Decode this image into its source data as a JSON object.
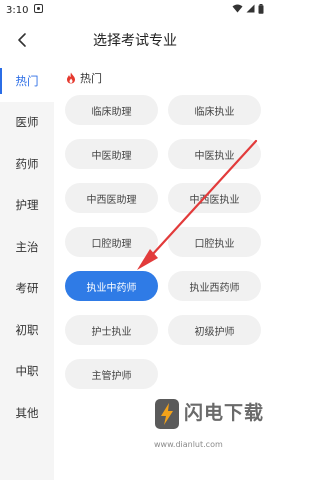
{
  "status_bar": {
    "time": "3:10"
  },
  "nav": {
    "title": "选择考试专业"
  },
  "sidebar": {
    "items": [
      {
        "label": "热门",
        "active": true
      },
      {
        "label": "医师"
      },
      {
        "label": "药师"
      },
      {
        "label": "护理"
      },
      {
        "label": "主治"
      },
      {
        "label": "考研"
      },
      {
        "label": "初职"
      },
      {
        "label": "中职"
      },
      {
        "label": "其他"
      }
    ]
  },
  "section": {
    "title": "热门",
    "icon": "fire-icon"
  },
  "tags": [
    "临床助理",
    "临床执业",
    "中医助理",
    "中医执业",
    "中西医助理",
    "中西医执业",
    "口腔助理",
    "口腔执业",
    "执业中药师",
    "执业西药师",
    "护士执业",
    "初级护师",
    "主管护师"
  ],
  "selected_tag": "执业中药师",
  "colors": {
    "accent": "#2f7be6",
    "arrow": "#e23b3b"
  },
  "watermark": {
    "title": "闪电下载",
    "url": "www.dianlut.com"
  }
}
